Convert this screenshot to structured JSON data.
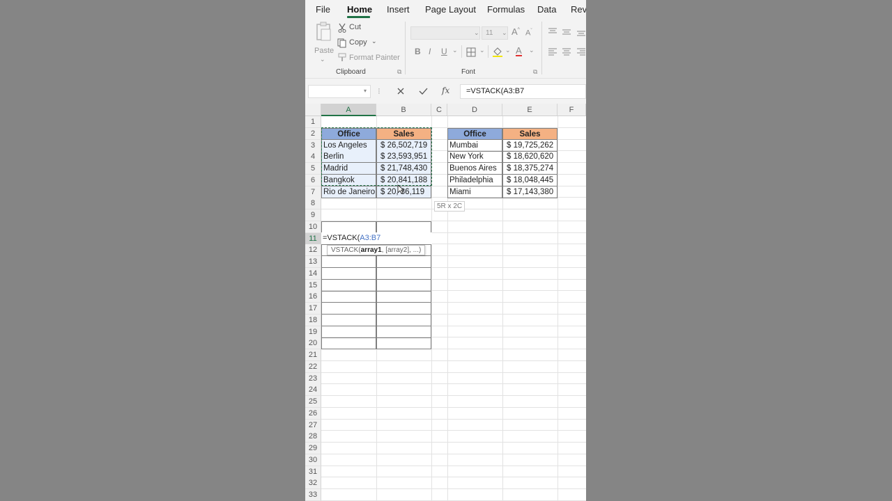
{
  "menu": {
    "tabs": [
      "File",
      "Home",
      "Insert",
      "Page Layout",
      "Formulas",
      "Data",
      "Revi"
    ],
    "active": "Home"
  },
  "ribbon": {
    "clipboard": {
      "paste_label": "Paste",
      "cut_label": "Cut",
      "copy_label": "Copy",
      "format_painter_label": "Format Painter",
      "group_label": "Clipboard"
    },
    "font": {
      "size_value": "11",
      "group_label": "Font",
      "bold": "B",
      "italic": "I",
      "underline": "U",
      "font_color_letter": "A"
    }
  },
  "formula_bar": {
    "namebox_value": "",
    "cancel_icon": "x-icon",
    "enter_icon": "check-icon",
    "fx_label": "fx",
    "formula": "=VSTACK(A3:B7"
  },
  "grid": {
    "columns": [
      "A",
      "B",
      "C",
      "D",
      "E",
      "F"
    ],
    "selected_column": "A",
    "selected_row": "11",
    "rows": [
      "1",
      "2",
      "3",
      "4",
      "5",
      "6",
      "7",
      "8",
      "9",
      "10",
      "11",
      "12",
      "13",
      "14",
      "15",
      "16",
      "17",
      "18",
      "19",
      "20",
      "21",
      "22",
      "23",
      "24",
      "25",
      "26",
      "27",
      "28",
      "29",
      "30",
      "31",
      "32",
      "33"
    ],
    "table1": {
      "headers": [
        "Office",
        "Sales"
      ],
      "rows": [
        [
          "Los Angeles",
          "$ 26,502,719"
        ],
        [
          "Berlin",
          "$ 23,593,951"
        ],
        [
          "Madrid",
          "$ 21,748,430"
        ],
        [
          "Bangkok",
          "$ 20,841,188"
        ],
        [
          "Rio de Janeiro",
          "$ 20,  86,119"
        ]
      ]
    },
    "table2": {
      "headers": [
        "Office",
        "Sales"
      ],
      "rows": [
        [
          "Mumbai",
          "$ 19,725,262"
        ],
        [
          "New York",
          "$ 18,620,620"
        ],
        [
          "Buenos Aires",
          "$ 18,375,274"
        ],
        [
          "Philadelphia",
          "$ 18,048,445"
        ],
        [
          "Miami",
          "$ 17,143,380"
        ]
      ]
    },
    "selection_size_tip": "5R x 2C",
    "edit_cell": {
      "prefix": "=VSTACK(",
      "ref": "A3:B7"
    },
    "function_tooltip": {
      "name": "VSTACK(",
      "arg1": "array1",
      "rest": ", [array2], ...)"
    }
  },
  "colors": {
    "accent_green": "#217346",
    "header_blue": "#8eaadb",
    "header_orange": "#f4b183"
  }
}
